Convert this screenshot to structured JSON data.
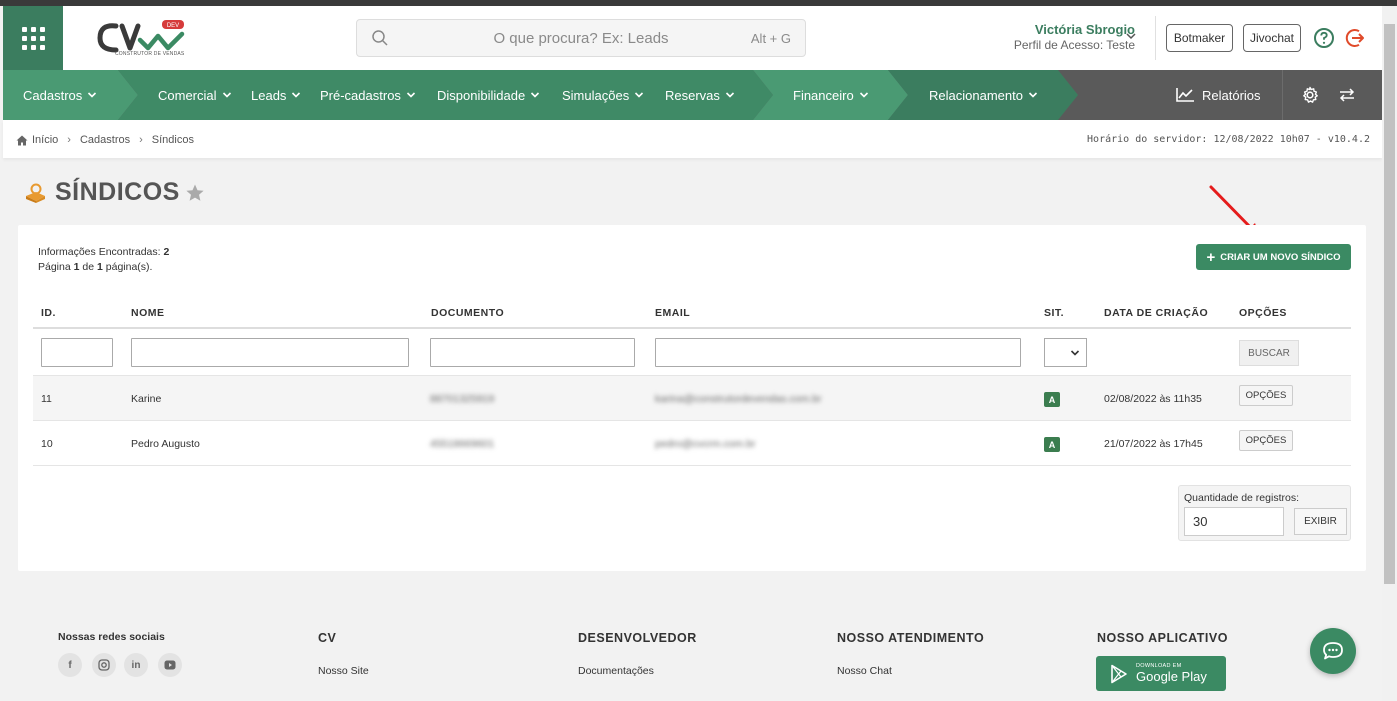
{
  "header": {
    "search_placeholder": "O que procura? Ex: Leads",
    "search_shortcut": "Alt + G",
    "user_name": "Victória Sbrogio",
    "user_role": "Perfil de Acesso: Teste",
    "btn_botmaker": "Botmaker",
    "btn_jivochat": "Jivochat",
    "logo_badge": "DEV",
    "logo_sub": "CONSTRUTOR DE VENDAS"
  },
  "nav": {
    "items": [
      "Cadastros",
      "Comercial",
      "Leads",
      "Pré-cadastros",
      "Disponibilidade",
      "Simulações",
      "Reservas",
      "Financeiro",
      "Relacionamento"
    ],
    "reports": "Relatórios",
    "colors": {
      "seg1": "#4a9a73",
      "seg2": "#3f8a66",
      "seg3": "#4a9a73",
      "seg4": "#3b7d5f",
      "rest": "#5a5a5a"
    }
  },
  "breadcrumb": {
    "items": [
      "Início",
      "Cadastros",
      "Síndicos"
    ],
    "server_time": "Horário do servidor: 12/08/2022 10h07 - v10.4.2"
  },
  "page": {
    "title": "SÍNDICOS",
    "info_found_label": "Informações Encontradas:",
    "info_found_value": "2",
    "info_page_pre": "Página",
    "info_page_cur": "1",
    "info_page_mid": "de",
    "info_page_total": "1",
    "info_page_suf": "página(s).",
    "create_button": "CRIAR UM NOVO SÍNDICO"
  },
  "table": {
    "headers": [
      "ID.",
      "NOME",
      "DOCUMENTO",
      "EMAIL",
      "SIT.",
      "DATA DE CRIAÇÃO",
      "OPÇÕES"
    ],
    "search_button": "BUSCAR",
    "rows": [
      {
        "id": "11",
        "nome": "Karine",
        "documento": "88701325919",
        "email": "karina@construtordevendas.com.br",
        "sit": "A",
        "data": "02/08/2022 às 11h35",
        "opcoes": "OPÇÕES"
      },
      {
        "id": "10",
        "nome": "Pedro Augusto",
        "documento": "45518669601",
        "email": "pedro@cvcrm.com.br",
        "sit": "A",
        "data": "21/07/2022 às 17h45",
        "opcoes": "OPÇÕES"
      }
    ]
  },
  "pagination": {
    "qty_label": "Quantidade de registros:",
    "qty_value": "30",
    "show_button": "EXIBIR"
  },
  "footer": {
    "social_title": "Nossas redes sociais",
    "cv_title": "CV",
    "cv_link": "Nosso Site",
    "dev_title": "DESENVOLVEDOR",
    "dev_link": "Documentações",
    "support_title": "NOSSO ATENDIMENTO",
    "support_link": "Nosso Chat",
    "app_title": "NOSSO APLICATIVO",
    "gplay_small": "DOWNLOAD EM",
    "gplay_big": "Google Play"
  }
}
